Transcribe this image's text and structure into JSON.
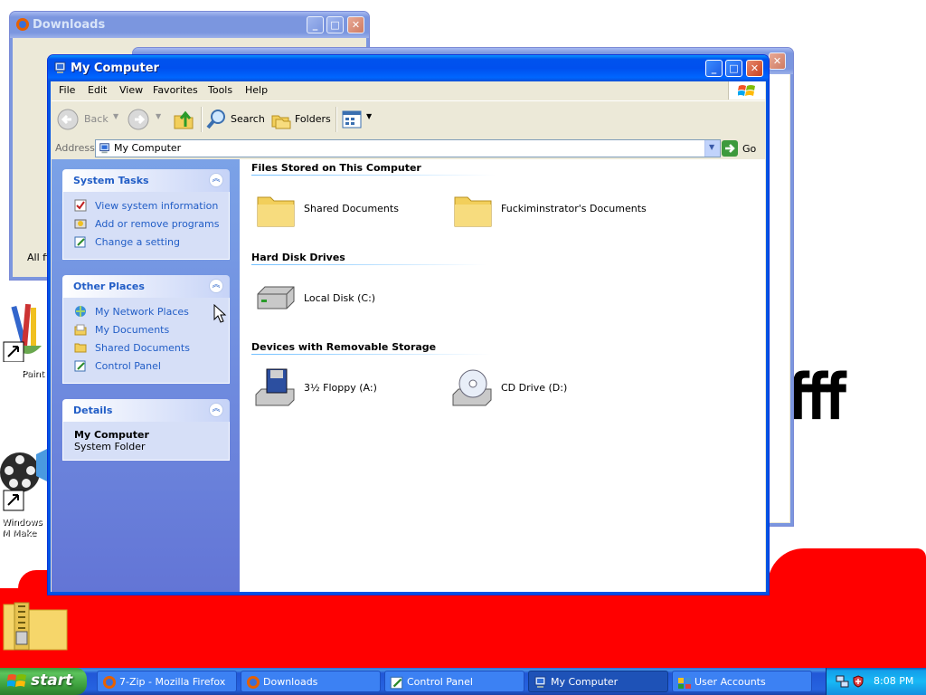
{
  "windows": {
    "downloads_bg": {
      "title": "Downloads",
      "partial_text": "All fi"
    },
    "main": {
      "title": "My Computer",
      "menu": [
        "File",
        "Edit",
        "View",
        "Favorites",
        "Tools",
        "Help"
      ],
      "toolbar": {
        "back": "Back",
        "search": "Search",
        "folders": "Folders"
      },
      "address": {
        "label": "Address",
        "value": "My Computer",
        "go": "Go"
      },
      "taskpane": {
        "system_tasks": {
          "title": "System Tasks",
          "items": [
            "View system information",
            "Add or remove programs",
            "Change a setting"
          ]
        },
        "other_places": {
          "title": "Other Places",
          "items": [
            "My Network Places",
            "My Documents",
            "Shared Documents",
            "Control Panel"
          ]
        },
        "details": {
          "title": "Details",
          "name": "My Computer",
          "type": "System Folder"
        }
      },
      "groups": {
        "files": {
          "title": "Files Stored on This Computer",
          "items": [
            "Shared Documents",
            "Fuckiminstrator's Documents"
          ]
        },
        "hdd": {
          "title": "Hard Disk Drives",
          "items": [
            "Local Disk (C:)"
          ]
        },
        "removable": {
          "title": "Devices with Removable Storage",
          "items": [
            "3½ Floppy (A:)",
            "CD Drive (D:)"
          ]
        }
      }
    }
  },
  "desktop": {
    "icons": [
      "Paint",
      "Windows M Make"
    ],
    "canvas_text": "fff"
  },
  "taskbar": {
    "start": "start",
    "buttons": [
      "7-Zip - Mozilla Firefox",
      "Downloads",
      "Control Panel",
      "My Computer",
      "User Accounts"
    ],
    "active_button": "My Computer",
    "clock": "8:08 PM"
  },
  "colors": {
    "titlebar": "#0054e3",
    "taskbar": "#245edb",
    "start": "#3c9a3c",
    "link": "#215dc6",
    "red": "#ff0000"
  }
}
